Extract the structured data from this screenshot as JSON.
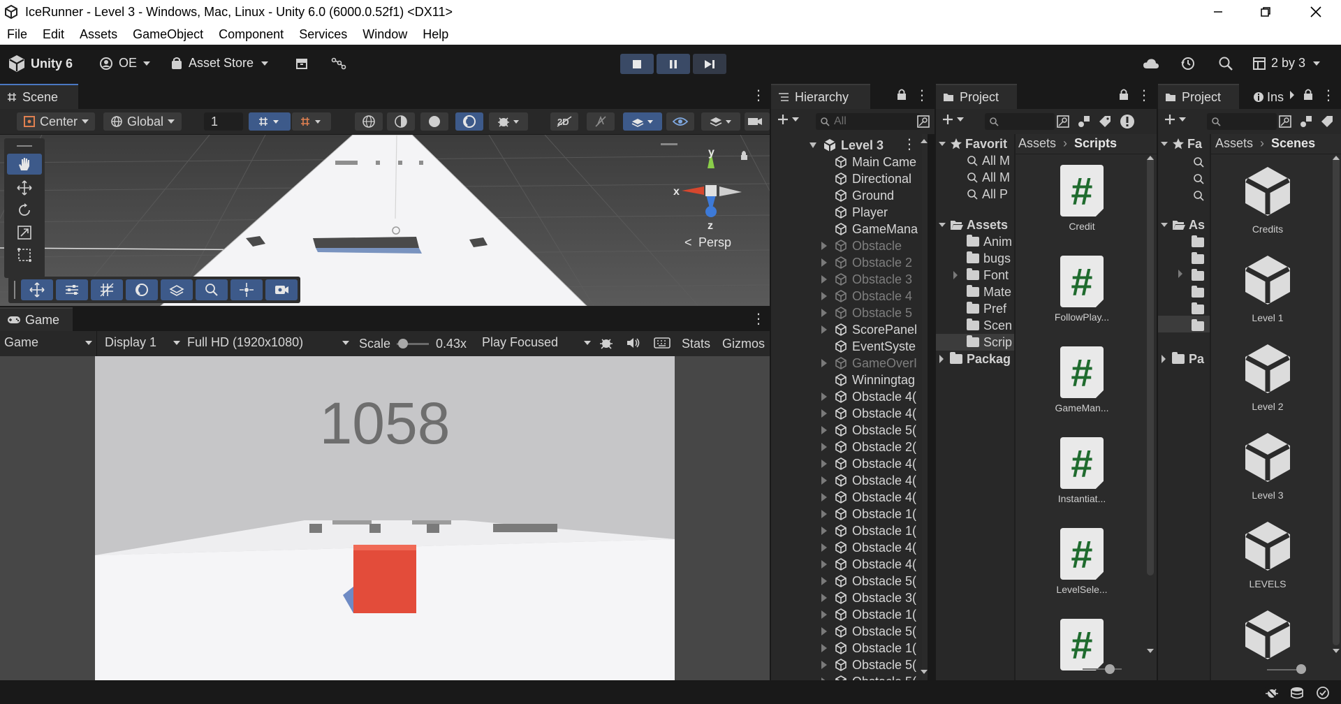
{
  "window": {
    "title": "IceRunner - Level 3 - Windows, Mac, Linux - Unity 6.0 (6000.0.52f1) <DX11>"
  },
  "menu": [
    "File",
    "Edit",
    "Assets",
    "GameObject",
    "Component",
    "Services",
    "Window",
    "Help"
  ],
  "toolbar": {
    "unity_label": "Unity 6",
    "account_label": "OE",
    "asset_store_label": "Asset Store",
    "layout_label": "2 by 3"
  },
  "scene": {
    "tab_label": "Scene",
    "pivot_label": "Center",
    "space_label": "Global",
    "snap_value": "1",
    "persp_label": "Persp",
    "axes": {
      "y": "y",
      "x": "x",
      "z": "z"
    }
  },
  "game": {
    "tab_label": "Game",
    "mode_label": "Game",
    "display_label": "Display 1",
    "resolution_label": "Full HD (1920x1080)",
    "scale_label": "Scale",
    "scale_value": "0.43x",
    "play_mode_label": "Play Focused",
    "stats_label": "Stats",
    "gizmos_label": "Gizmos",
    "score": "1058"
  },
  "hierarchy": {
    "tab_label": "Hierarchy",
    "search_placeholder": "All",
    "scene_name": "Level 3",
    "items": [
      {
        "label": "Main Came",
        "expandable": false,
        "dim": false
      },
      {
        "label": "Directional",
        "expandable": false,
        "dim": false
      },
      {
        "label": "Ground",
        "expandable": false,
        "dim": false
      },
      {
        "label": "Player",
        "expandable": false,
        "dim": false
      },
      {
        "label": "GameMana",
        "expandable": false,
        "dim": false
      },
      {
        "label": "Obstacle",
        "expandable": true,
        "dim": true
      },
      {
        "label": "Obstacle 2",
        "expandable": true,
        "dim": true
      },
      {
        "label": "Obstacle 3",
        "expandable": true,
        "dim": true
      },
      {
        "label": "Obstacle 4",
        "expandable": true,
        "dim": true
      },
      {
        "label": "Obstacle 5",
        "expandable": true,
        "dim": true
      },
      {
        "label": "ScorePanel",
        "expandable": true,
        "dim": false
      },
      {
        "label": "EventSyste",
        "expandable": false,
        "dim": false
      },
      {
        "label": "GameOverI",
        "expandable": true,
        "dim": true
      },
      {
        "label": "Winningtag",
        "expandable": false,
        "dim": false
      },
      {
        "label": "Obstacle 4(",
        "expandable": true,
        "dim": false
      },
      {
        "label": "Obstacle 4(",
        "expandable": true,
        "dim": false
      },
      {
        "label": "Obstacle 5(",
        "expandable": true,
        "dim": false
      },
      {
        "label": "Obstacle 2(",
        "expandable": true,
        "dim": false
      },
      {
        "label": "Obstacle 4(",
        "expandable": true,
        "dim": false
      },
      {
        "label": "Obstacle 4(",
        "expandable": true,
        "dim": false
      },
      {
        "label": "Obstacle 4(",
        "expandable": true,
        "dim": false
      },
      {
        "label": "Obstacle 1(",
        "expandable": true,
        "dim": false
      },
      {
        "label": "Obstacle 1(",
        "expandable": true,
        "dim": false
      },
      {
        "label": "Obstacle 4(",
        "expandable": true,
        "dim": false
      },
      {
        "label": "Obstacle 4(",
        "expandable": true,
        "dim": false
      },
      {
        "label": "Obstacle 5(",
        "expandable": true,
        "dim": false
      },
      {
        "label": "Obstacle 3(",
        "expandable": true,
        "dim": false
      },
      {
        "label": "Obstacle 1(",
        "expandable": true,
        "dim": false
      },
      {
        "label": "Obstacle 5(",
        "expandable": true,
        "dim": false
      },
      {
        "label": "Obstacle 1(",
        "expandable": true,
        "dim": false
      },
      {
        "label": "Obstacle 5(",
        "expandable": true,
        "dim": false
      },
      {
        "label": "Obstacle 5(",
        "expandable": true,
        "dim": false
      }
    ]
  },
  "project1": {
    "tab_label": "Project",
    "favorites_label": "Favorit",
    "favorites": [
      "All M",
      "All M",
      "All P"
    ],
    "assets_label": "Assets",
    "folders": [
      "Anim",
      "bugs",
      "Font",
      "Mate",
      "Pref",
      "Scen",
      "Scrip"
    ],
    "packages_label": "Packag",
    "breadcrumb": [
      "Assets",
      "Scripts"
    ],
    "files": [
      "Credit",
      "FollowPlay...",
      "GameMan...",
      "Instantiat...",
      "LevelSele...",
      ""
    ]
  },
  "project2": {
    "tab_label": "Project",
    "inspector_label": "Ins",
    "favorites_label": "Fa",
    "assets_label": "As",
    "packages_label": "Pa",
    "breadcrumb": [
      "Assets",
      "Scenes"
    ],
    "files": [
      "Credits",
      "Level 1",
      "Level 2",
      "Level 3",
      "LEVELS",
      ""
    ]
  },
  "colors": {
    "accent_blue": "#3d5a8a",
    "player_red": "#e34c3a",
    "script_green": "#1f6b2e"
  }
}
